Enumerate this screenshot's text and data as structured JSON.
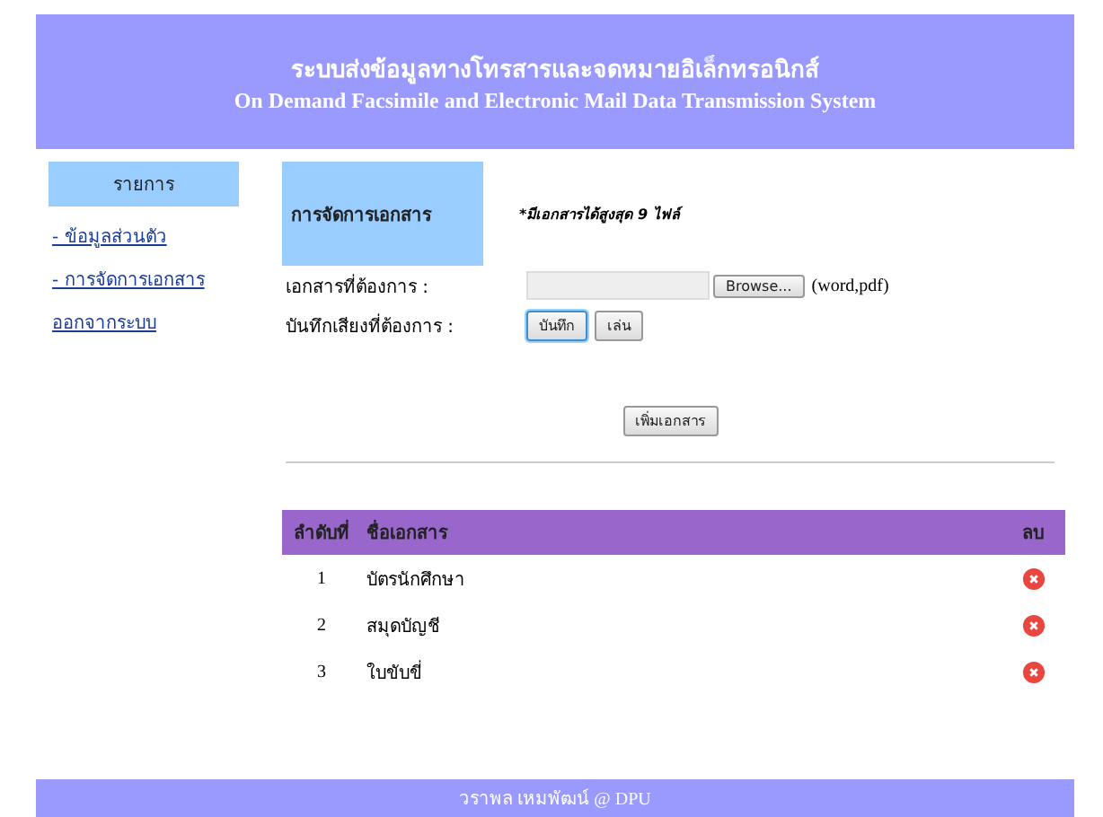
{
  "header": {
    "title_th": "ระบบส่งข้อมูลทางโทรสารและจดหมายอิเล็กทรอนิกส์",
    "title_en": "On Demand Facsimile and Electronic Mail Data Transmission System"
  },
  "sidebar": {
    "title": "รายการ",
    "items": [
      {
        "label": "- ข้อมูลส่วนตัว"
      },
      {
        "label": "- การจัดการเอกสาร"
      },
      {
        "label": "ออกจากระบบ"
      }
    ]
  },
  "main": {
    "section_title": "การจัดการเอกสาร",
    "note": "*มีเอกสารได้สูงสุด 9 ไฟล์",
    "file_label": "เอกสารที่ต้องการ :",
    "browse_button": "Browse...",
    "file_types": "(word,pdf)",
    "record_label": "บันทึกเสียงที่ต้องการ :",
    "record_buttons": [
      {
        "label": "บันทึก",
        "focused": true
      },
      {
        "label": "เล่น",
        "focused": false
      }
    ],
    "add_button": "เพิ่มเอกสาร"
  },
  "table": {
    "columns": [
      "ลำดับที่",
      "ชื่อเอกสาร",
      "ลบ"
    ],
    "rows": [
      {
        "no": "1",
        "name": "บัตรนักศึกษา"
      },
      {
        "no": "2",
        "name": "สมุดบัญชี"
      },
      {
        "no": "3",
        "name": "ใบขับขี่"
      }
    ]
  },
  "footer": "วราพล เหมพัฒน์ @ DPU"
}
